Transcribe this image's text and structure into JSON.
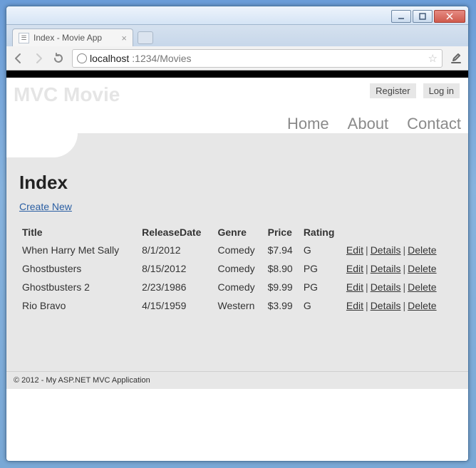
{
  "window": {
    "tab_title": "Index - Movie App",
    "url_host": "localhost",
    "url_port_path": ":1234/Movies"
  },
  "header": {
    "brand": "MVC Movie",
    "auth": {
      "register": "Register",
      "login": "Log in"
    },
    "nav": {
      "home": "Home",
      "about": "About",
      "contact": "Contact"
    }
  },
  "page": {
    "heading": "Index",
    "create_link": "Create New",
    "columns": {
      "title": "Title",
      "release": "ReleaseDate",
      "genre": "Genre",
      "price": "Price",
      "rating": "Rating"
    },
    "actions": {
      "edit": "Edit",
      "details": "Details",
      "delete": "Delete"
    },
    "rows": [
      {
        "title": "When Harry Met Sally",
        "release": "8/1/2012",
        "genre": "Comedy",
        "price": "$7.94",
        "rating": "G"
      },
      {
        "title": "Ghostbusters",
        "release": "8/15/2012",
        "genre": "Comedy",
        "price": "$8.90",
        "rating": "PG"
      },
      {
        "title": "Ghostbusters 2",
        "release": "2/23/1986",
        "genre": "Comedy",
        "price": "$9.99",
        "rating": "PG"
      },
      {
        "title": "Rio Bravo",
        "release": "4/15/1959",
        "genre": "Western",
        "price": "$3.99",
        "rating": "G"
      }
    ]
  },
  "footer": {
    "text": "© 2012 - My ASP.NET MVC Application"
  }
}
